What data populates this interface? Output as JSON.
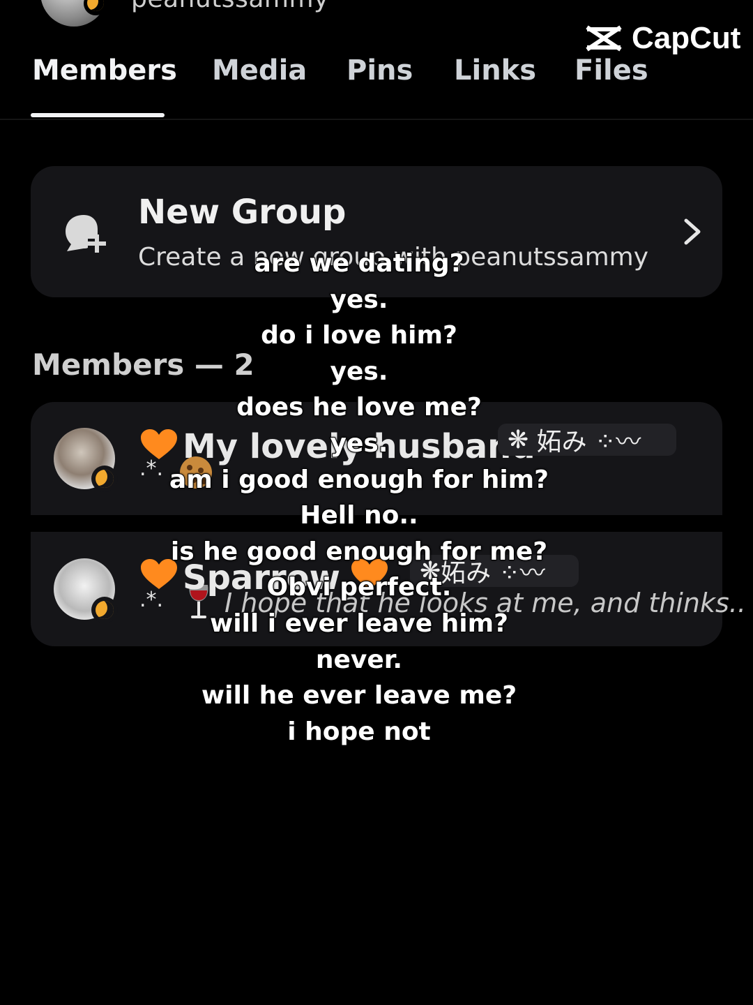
{
  "header": {
    "username": "peanutssammy"
  },
  "watermark": {
    "label": "CapCut"
  },
  "tabs": [
    {
      "label": "Members",
      "active": true
    },
    {
      "label": "Media"
    },
    {
      "label": "Pins"
    },
    {
      "label": "Links"
    },
    {
      "label": "Files"
    }
  ],
  "new_group": {
    "title": "New Group",
    "subtitle": "Create a new group with peanutssammy"
  },
  "members": {
    "header": "Members — 2",
    "list": [
      {
        "name": "My lovely husband",
        "tag": "妬み",
        "status_sparkle": ".*.",
        "moon_color": "#f2a92e"
      },
      {
        "name": "Sparrow",
        "tag": "妬み",
        "status_sparkle": ".*.",
        "status": "I hope that he looks at me, and thinks.."
      }
    ]
  },
  "caption": {
    "lines": [
      "are we dating?",
      "yes.",
      "do i love him?",
      "yes.",
      "does he love me?",
      "yes.",
      "am i good enough for him?",
      "Hell no..",
      "is he good enough for me?",
      "Obvi perfect.",
      "will i ever leave him?",
      "never.",
      "will he ever leave me?",
      "i hope not"
    ]
  },
  "colors": {
    "background": "#000000",
    "card": "#151518",
    "accent_moon": "#f2a92e",
    "heart": "#ff8a1e"
  }
}
